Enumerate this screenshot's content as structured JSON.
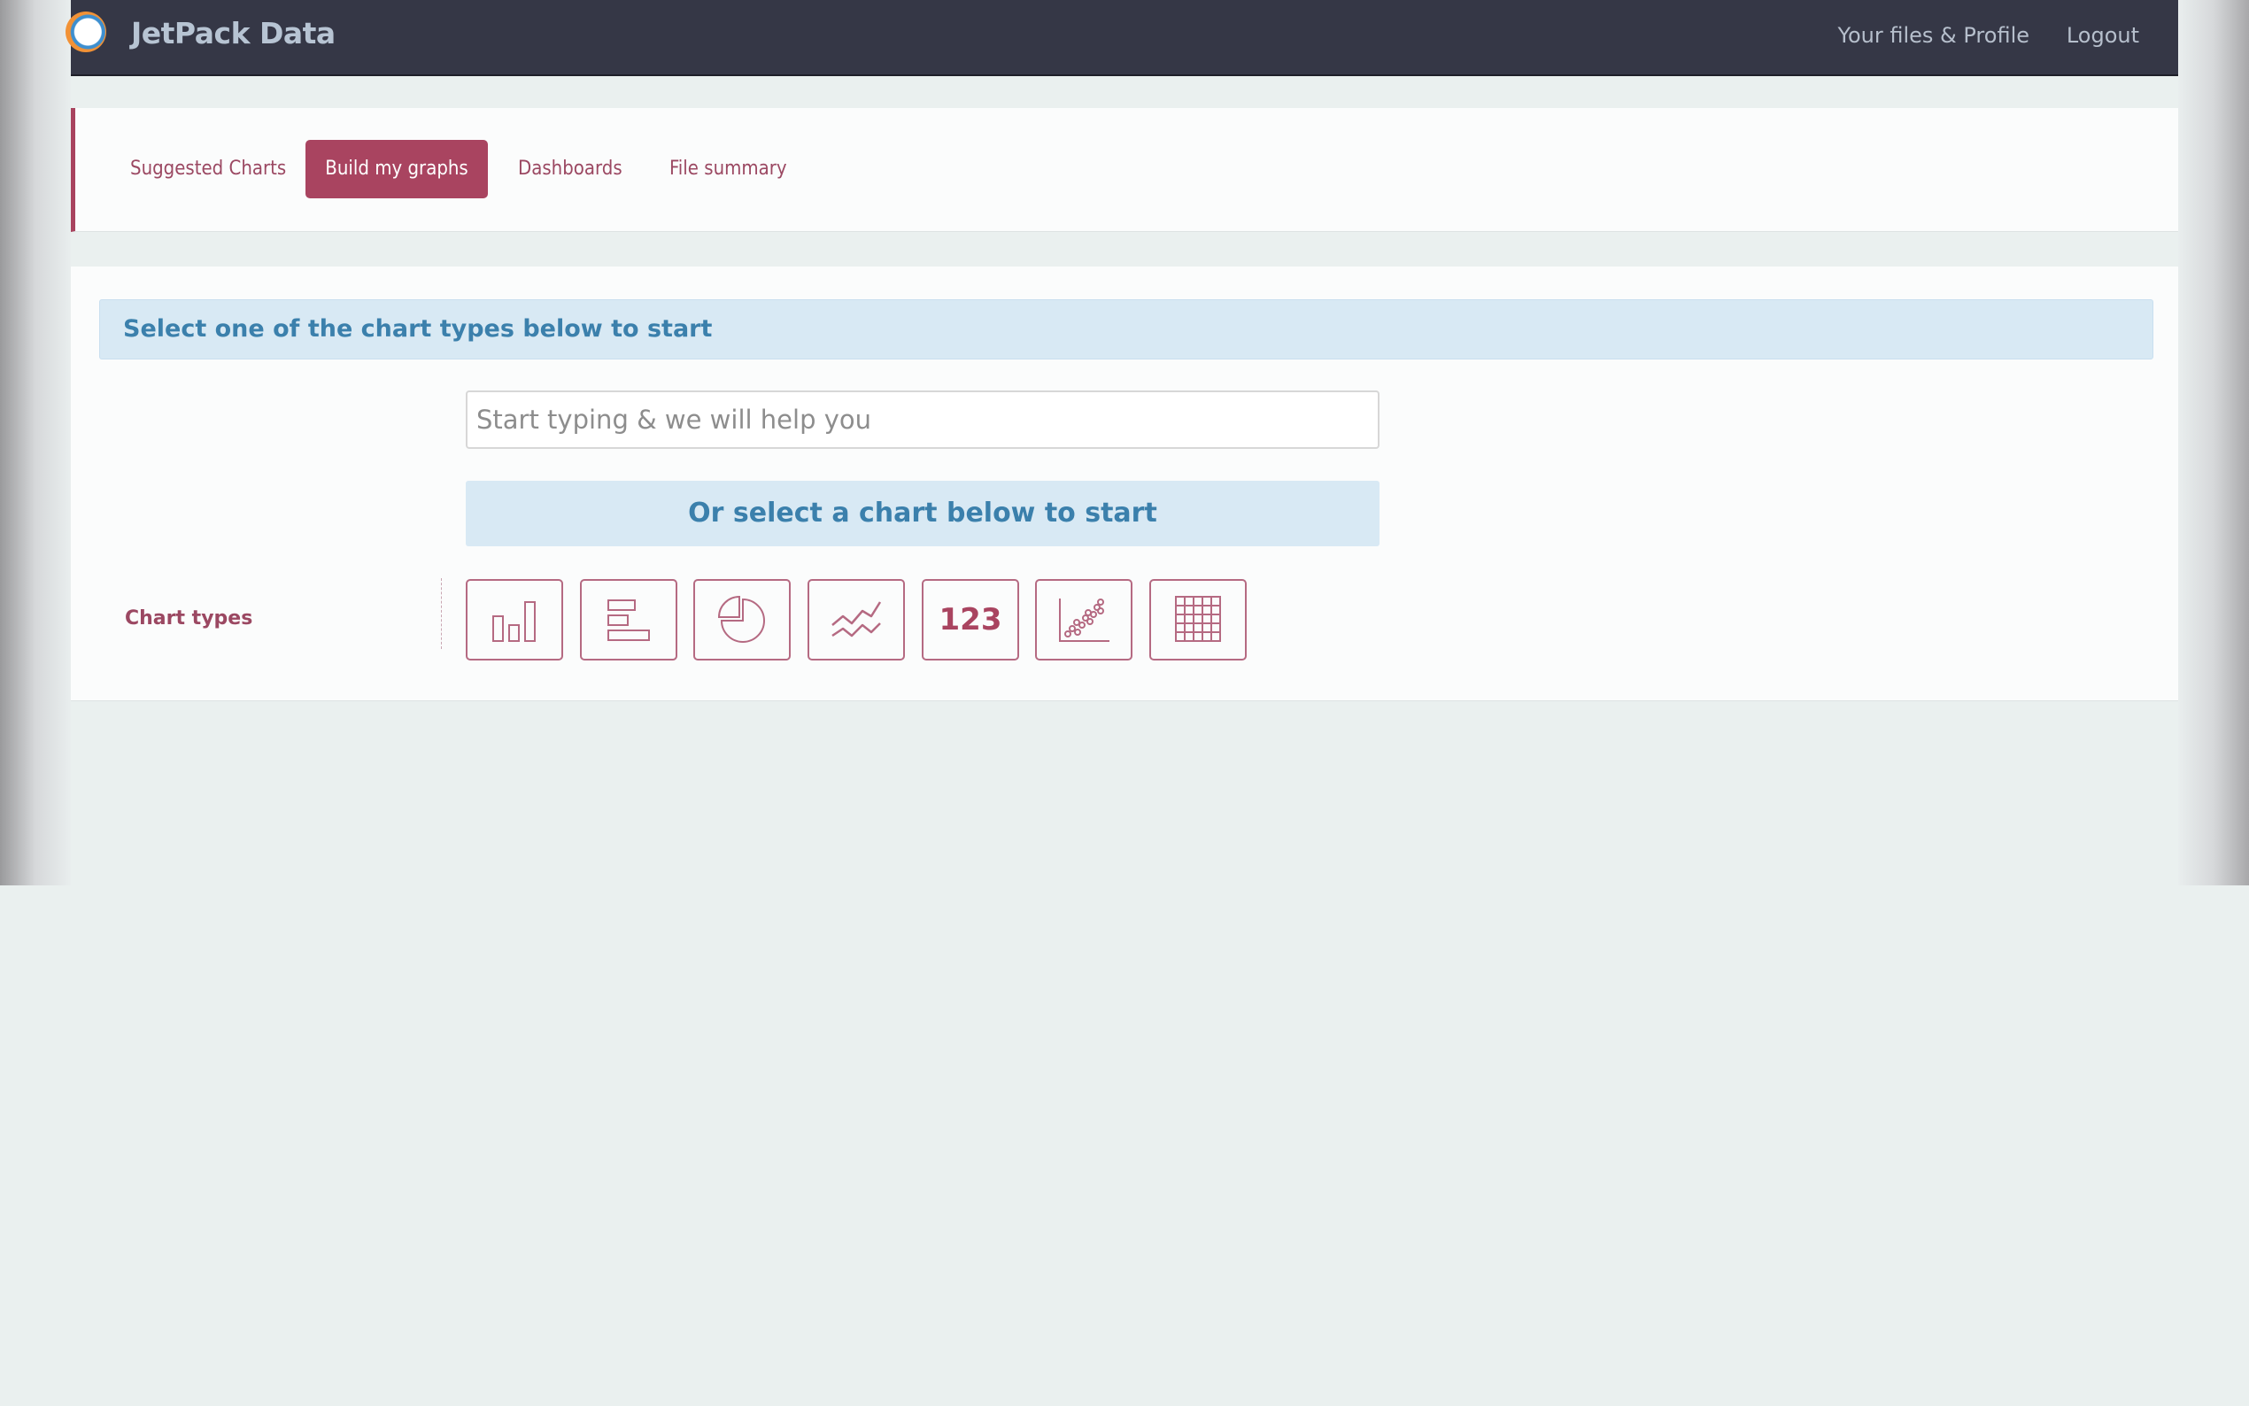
{
  "app": {
    "brand": "JetPack Data"
  },
  "header": {
    "links": {
      "files_profile": "Your files & Profile",
      "logout": "Logout"
    }
  },
  "tabs": [
    {
      "label": "Suggested Charts",
      "active": false
    },
    {
      "label": "Build my graphs",
      "active": true
    },
    {
      "label": "Dashboards",
      "active": false
    },
    {
      "label": "File summary",
      "active": false
    }
  ],
  "main": {
    "info_message": "Select one of the chart types below to start",
    "search": {
      "placeholder": "Start typing & we will help you",
      "value": ""
    },
    "select_message": "Or select a chart below to start",
    "chart_types_label": "Chart types",
    "chart_types": [
      {
        "icon": "vertical-bar-chart-icon"
      },
      {
        "icon": "horizontal-bar-chart-icon"
      },
      {
        "icon": "pie-chart-icon"
      },
      {
        "icon": "line-chart-icon"
      },
      {
        "icon": "number-indicator-icon",
        "text": "123"
      },
      {
        "icon": "scatter-plot-icon"
      },
      {
        "icon": "table-icon"
      }
    ]
  },
  "colors": {
    "navbar_bg": "#353746",
    "accent": "#a94460",
    "info_bg": "#d8e9f4",
    "info_text": "#3b80ac"
  }
}
